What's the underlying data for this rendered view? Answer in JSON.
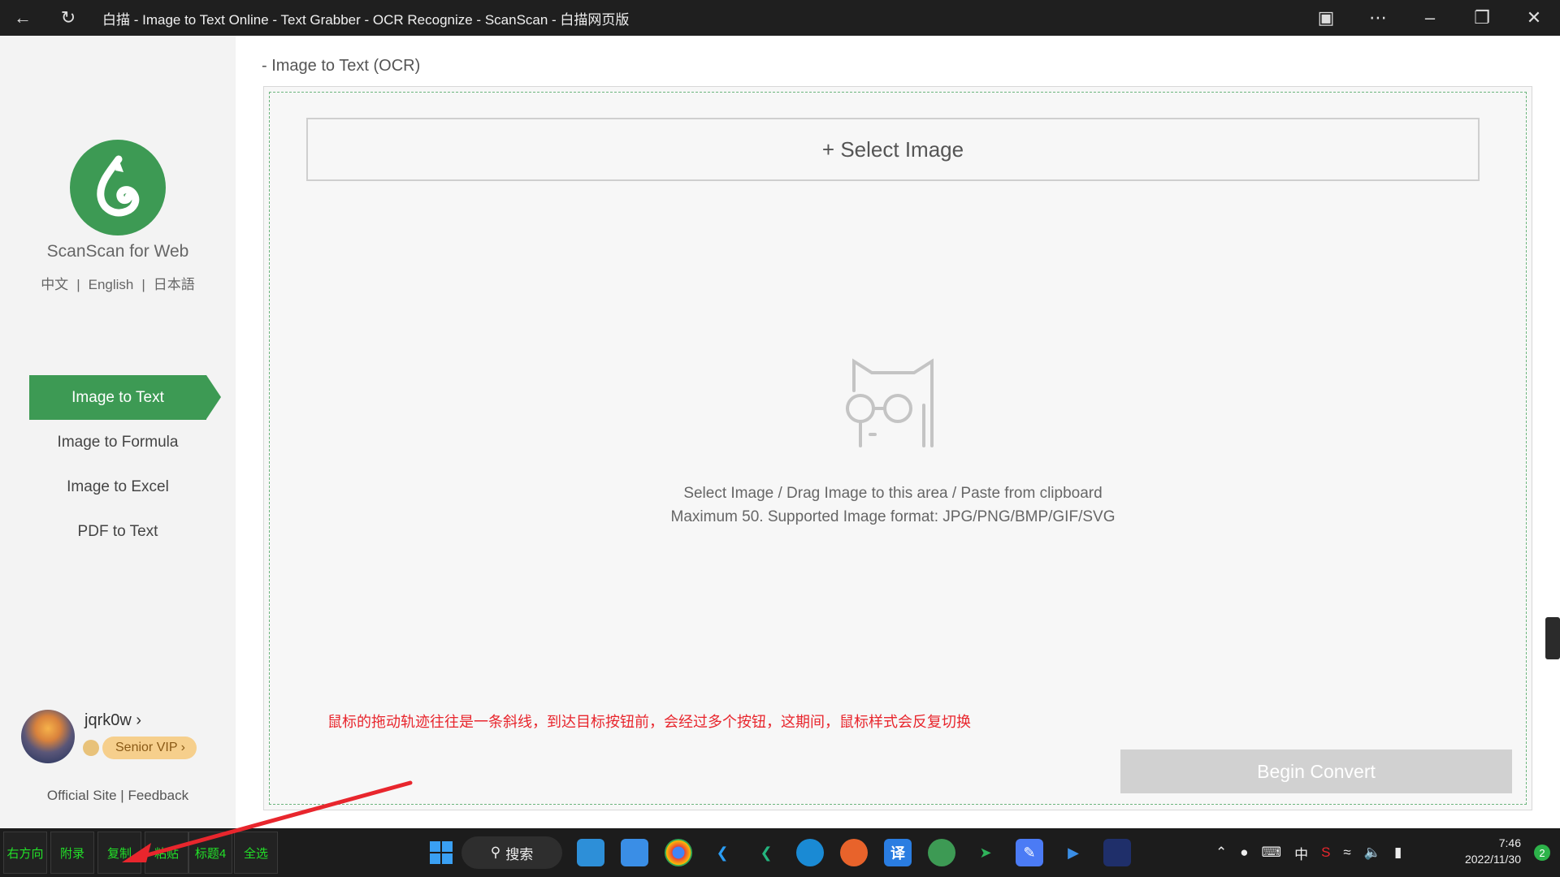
{
  "window": {
    "title": "白描 - Image to Text Online - Text Grabber - OCR Recognize - ScanScan - 白描网页版"
  },
  "sidebar": {
    "brand": "ScanScan for Web",
    "languages": [
      "中文",
      "English",
      "日本語"
    ],
    "separator": "|",
    "nav": [
      {
        "label": "Image to Text",
        "active": true
      },
      {
        "label": "Image to Formula",
        "active": false
      },
      {
        "label": "Image to Excel",
        "active": false
      },
      {
        "label": "PDF to Text",
        "active": false
      }
    ],
    "user": {
      "name": "jqrk0w",
      "chevron": "›",
      "vip_label": "Senior VIP",
      "vip_chevron": "›"
    },
    "footer_links": {
      "official": "Official Site",
      "sep": " | ",
      "feedback": "Feedback"
    }
  },
  "main": {
    "heading": "- Image to Text (OCR)",
    "select_button": "+ Select Image",
    "hint_line1": "Select Image / Drag Image to this area / Paste from clipboard",
    "hint_line2": "Maximum 50. Supported Image format: JPG/PNG/BMP/GIF/SVG",
    "annotation": "鼠标的拖动轨迹往往是一条斜线，到达目标按钮前，会经过多个按钮，这期间，鼠标样式会反复切换",
    "begin_button": "Begin Convert"
  },
  "taskbar": {
    "quick_buttons": [
      "右方向",
      "附录",
      "复制",
      "粘贴",
      "标题4",
      "全选"
    ],
    "search_label": "搜索",
    "input_method": "中",
    "time": "7:46",
    "date": "2022/11/30",
    "notification_count": "2"
  },
  "colors": {
    "brand_green": "#3d9a54",
    "annotation_red": "#e8262d",
    "quick_button_text": "#22e028"
  }
}
